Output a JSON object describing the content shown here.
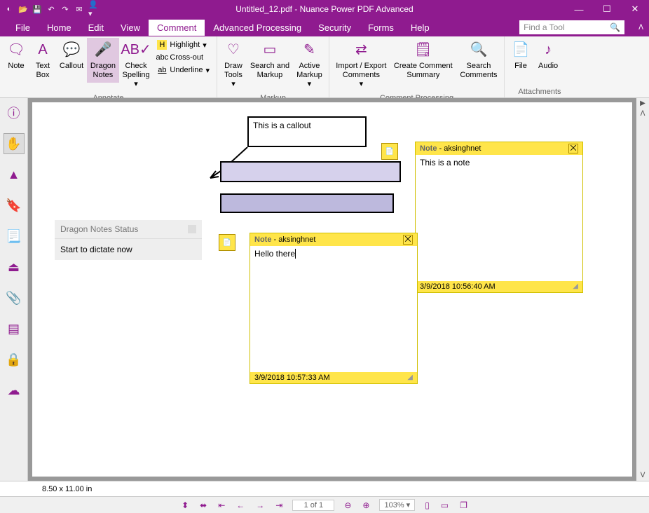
{
  "title": "Untitled_12.pdf - Nuance Power PDF Advanced",
  "search_placeholder": "Find a Tool",
  "menu": {
    "file": "File",
    "home": "Home",
    "edit": "Edit",
    "view": "View",
    "comment": "Comment",
    "advanced": "Advanced Processing",
    "security": "Security",
    "forms": "Forms",
    "help": "Help"
  },
  "ribbon": {
    "annotate": {
      "label": "Annotate",
      "note": "Note",
      "textbox": "Text\nBox",
      "callout": "Callout",
      "dragon": "Dragon\nNotes",
      "spelling": "Check\nSpelling",
      "highlight": "Highlight",
      "crossout": "Cross-out",
      "underline": "Underline"
    },
    "markup": {
      "label": "Markup",
      "draw": "Draw\nTools",
      "search": "Search and\nMarkup",
      "active": "Active\nMarkup"
    },
    "processing": {
      "label": "Comment Processing",
      "import": "Import / Export\nComments",
      "summary": "Create Comment\nSummary",
      "searchc": "Search\nComments"
    },
    "attachments": {
      "label": "Attachments",
      "file": "File",
      "audio": "Audio"
    }
  },
  "dragon": {
    "hdr": "Dragon Notes Status",
    "body": "Start to dictate now"
  },
  "callout_text": "This is a callout",
  "notes": [
    {
      "author": "aksinghnet",
      "label": "Note",
      "content": "This is a note",
      "ts": "3/9/2018 10:56:40 AM"
    },
    {
      "author": "aksinghnet",
      "label": "Note",
      "content": "Hello there",
      "ts": "3/9/2018 10:57:33 AM"
    }
  ],
  "status": {
    "dims": "8.50 x 11.00 in",
    "page": "1 of 1",
    "zoom": "103%"
  }
}
